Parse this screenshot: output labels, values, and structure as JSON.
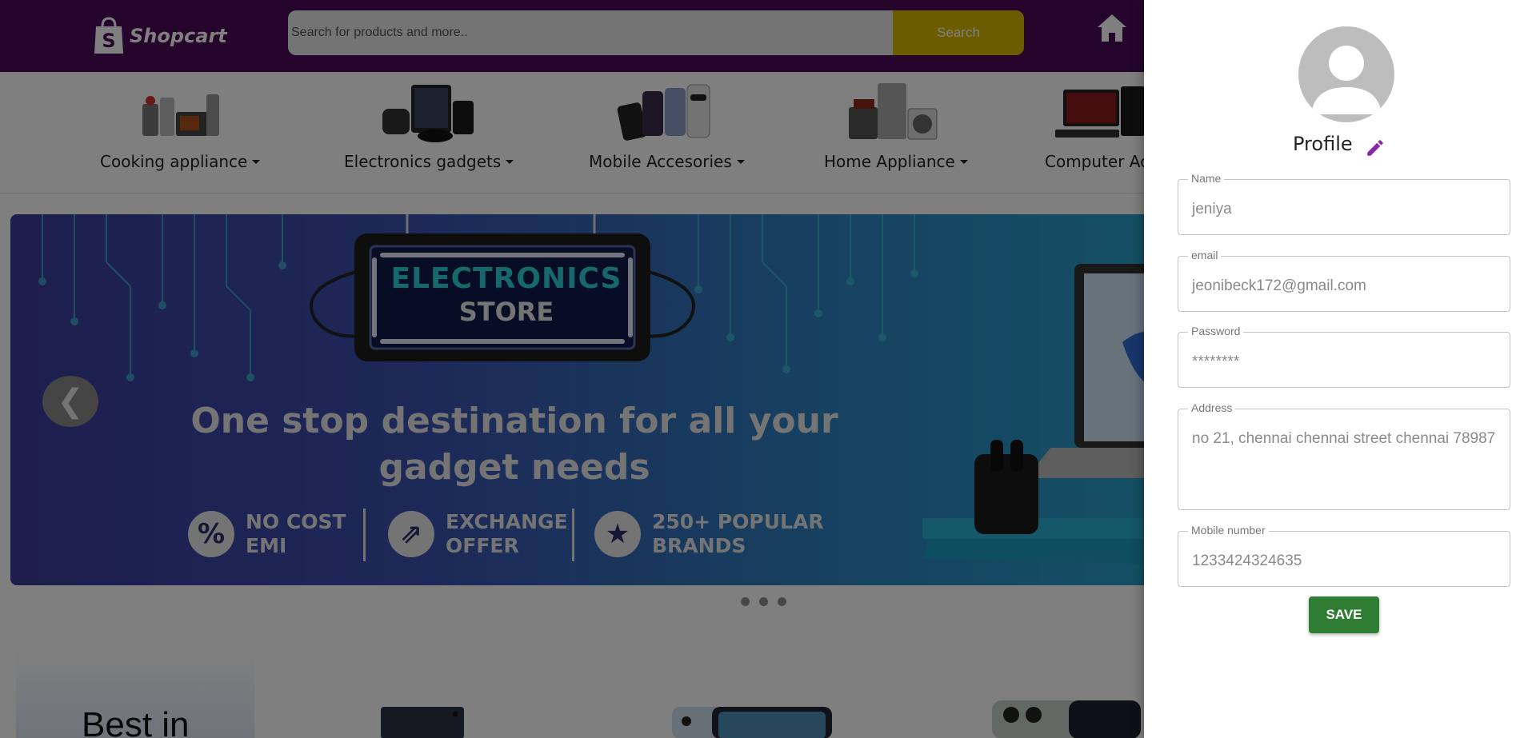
{
  "header": {
    "logo_text": "Shopcart",
    "logo_letter": "S",
    "search_placeholder": "Search for products and more..",
    "search_button": "Search"
  },
  "categories": [
    {
      "label": "Cooking appliance"
    },
    {
      "label": "Electronics gadgets"
    },
    {
      "label": "Mobile Accesories"
    },
    {
      "label": "Home Appliance"
    },
    {
      "label": "Computer Acc"
    }
  ],
  "banner": {
    "sign_line1": "ELECTRONICS",
    "sign_line2": "STORE",
    "headline_line1": "One stop destination for  all your",
    "headline_line2": "gadget needs",
    "features": [
      {
        "icon": "%",
        "line1": "NO COST",
        "line2": "EMI"
      },
      {
        "icon": "⇗",
        "line1": "EXCHANGE",
        "line2": "OFFER"
      },
      {
        "icon": "★",
        "line1": "250+ POPULAR",
        "line2": "BRANDS"
      }
    ],
    "prev_symbol": "❮"
  },
  "section": {
    "title": "Best in"
  },
  "profile": {
    "title": "Profile",
    "fields": {
      "name": {
        "label": "Name",
        "value": "jeniya"
      },
      "email": {
        "label": "email",
        "value": "jeonibeck172@gmail.com"
      },
      "password": {
        "label": "Password",
        "value": "********"
      },
      "address": {
        "label": "Address",
        "value": "no 21, chennai chennai street chennai 78987"
      },
      "mobile": {
        "label": "Mobile number",
        "value": "1233424324635"
      }
    },
    "save_button": "SAVE"
  },
  "colors": {
    "header_bg": "#4a0a58",
    "search_button_bg": "#d9b800",
    "save_button_bg": "#2e7d32",
    "edit_icon": "#8e24aa"
  }
}
